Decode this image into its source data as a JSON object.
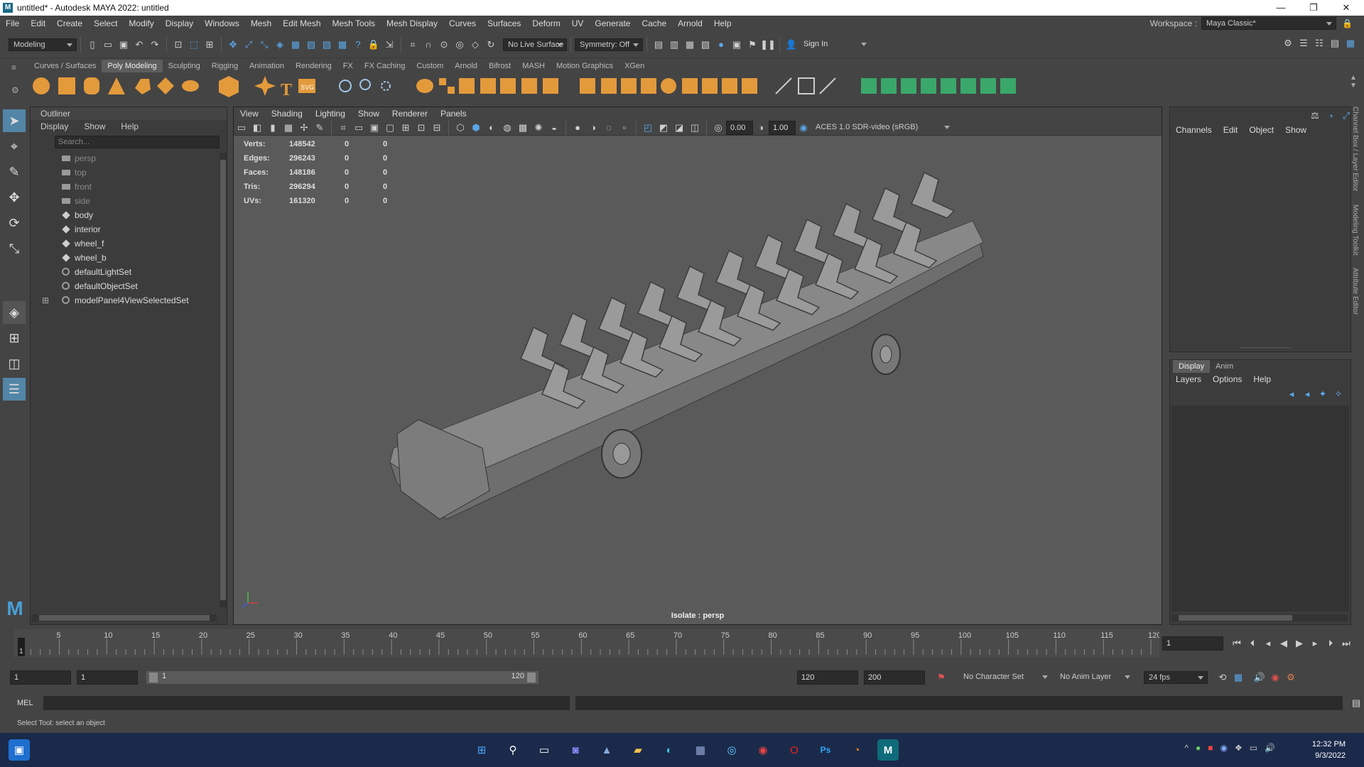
{
  "window": {
    "title": "untitled* - Autodesk MAYA 2022: untitled"
  },
  "menubar": {
    "items": [
      "File",
      "Edit",
      "Create",
      "Select",
      "Modify",
      "Display",
      "Windows",
      "Mesh",
      "Edit Mesh",
      "Mesh Tools",
      "Mesh Display",
      "Curves",
      "Surfaces",
      "Deform",
      "UV",
      "Generate",
      "Cache",
      "Arnold",
      "Help"
    ],
    "workspace_label": "Workspace :",
    "workspace_value": "Maya Classic*"
  },
  "statusline": {
    "menuset": "Modeling",
    "live_surface": "No Live Surface",
    "symmetry": "Symmetry: Off",
    "sign_in": "Sign In"
  },
  "shelf": {
    "tabs": [
      "Curves / Surfaces",
      "Poly Modeling",
      "Sculpting",
      "Rigging",
      "Animation",
      "Rendering",
      "FX",
      "FX Caching",
      "Custom",
      "Arnold",
      "Bifrost",
      "MASH",
      "Motion Graphics",
      "XGen"
    ],
    "active_tab": "Poly Modeling"
  },
  "outliner": {
    "title": "Outliner",
    "menus": [
      "Display",
      "Show",
      "Help"
    ],
    "search_placeholder": "Search...",
    "items": [
      "persp",
      "top",
      "front",
      "side",
      "body",
      "interior",
      "wheel_f",
      "wheel_b",
      "defaultLightSet",
      "defaultObjectSet",
      "modelPanel4ViewSelectedSet"
    ]
  },
  "viewport": {
    "menus": [
      "View",
      "Shading",
      "Lighting",
      "Show",
      "Renderer",
      "Panels"
    ],
    "exposure": "0.00",
    "gamma": "1.00",
    "color_space": "ACES 1.0 SDR-video (sRGB)",
    "isolate_label": "Isolate : persp",
    "hud": [
      {
        "label": "Verts:",
        "v1": "148542",
        "v2": "0",
        "v3": "0"
      },
      {
        "label": "Edges:",
        "v1": "296243",
        "v2": "0",
        "v3": "0"
      },
      {
        "label": "Faces:",
        "v1": "148186",
        "v2": "0",
        "v3": "0"
      },
      {
        "label": "Tris:",
        "v1": "296294",
        "v2": "0",
        "v3": "0"
      },
      {
        "label": "UVs:",
        "v1": "161320",
        "v2": "0",
        "v3": "0"
      }
    ]
  },
  "channelbox": {
    "menus": [
      "Channels",
      "Edit",
      "Object",
      "Show"
    ]
  },
  "layereditor": {
    "tabs": [
      "Display",
      "Anim"
    ],
    "menus": [
      "Layers",
      "Options",
      "Help"
    ]
  },
  "side_tabs": [
    "Channel Box / Layer Editor",
    "Modeling Toolkit",
    "Attribute Editor"
  ],
  "timeslider": {
    "ticks": [
      "5",
      "10",
      "15",
      "20",
      "25",
      "30",
      "35",
      "40",
      "45",
      "50",
      "55",
      "60",
      "65",
      "70",
      "75",
      "80",
      "85",
      "90",
      "95",
      "100",
      "105",
      "110",
      "115",
      "120"
    ],
    "current_marker": "1",
    "current_frame": "1"
  },
  "range": {
    "start": "1",
    "start2": "1",
    "slider_start": "1",
    "slider_end": "120",
    "end": "120",
    "end2": "200",
    "character_set": "No Character Set",
    "anim_layer": "No Anim Layer",
    "fps": "24 fps"
  },
  "cmdline": {
    "label": "MEL"
  },
  "helpline": {
    "text": "Select Tool: select an object"
  },
  "taskbar": {
    "time": "12:32 PM",
    "date": "9/3/2022"
  }
}
